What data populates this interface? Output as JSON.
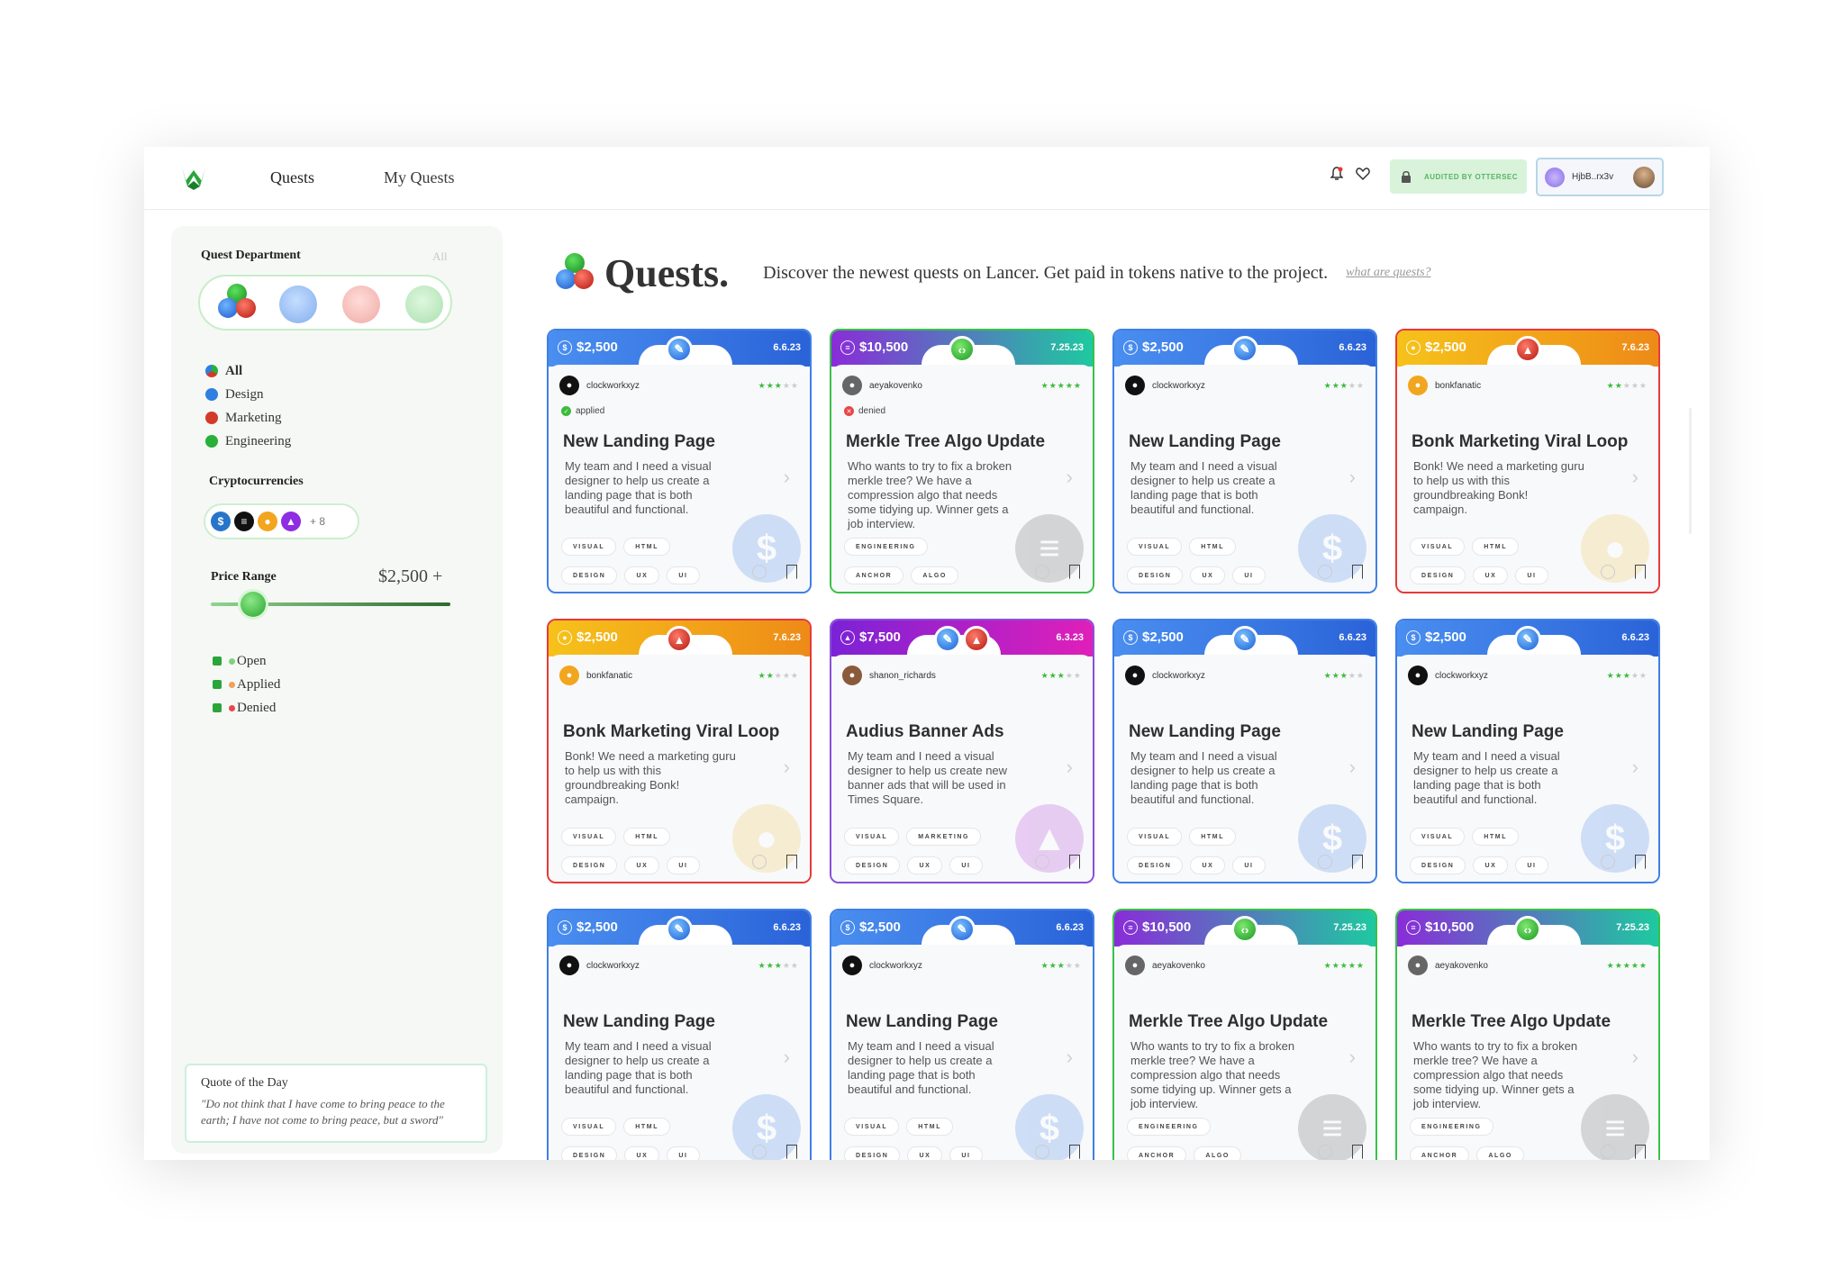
{
  "nav": {
    "links": [
      "Quests",
      "My Quests"
    ],
    "audit_label": "AUDITED BY OTTERSEC",
    "wallet_address": "HjbB..rx3v"
  },
  "sidebar": {
    "dept_title": "Quest Department",
    "dept_all": "All",
    "departments": [
      "All",
      "Design",
      "Marketing",
      "Engineering"
    ],
    "crypto_title": "Cryptocurrencies",
    "crypto_more": "+ 8",
    "price_title": "Price Range",
    "price_value": "$2,500 +",
    "price_slider_fraction": 0.15,
    "statuses": [
      "Open",
      "Applied",
      "Denied"
    ],
    "quote_title": "Quote of the Day",
    "quote_text": "\"Do not think that I have come to bring peace to the earth; I have not come to bring peace, but a sword\""
  },
  "header": {
    "title": "Quests.",
    "subtitle": "Discover the newest quests on Lancer. Get paid in tokens native to the project.",
    "link": "what are quests?"
  },
  "colors": {
    "design": "#2f7fe0",
    "engineering": "#27b03a",
    "marketing": "#d23a2a",
    "bonk": "#f0b020",
    "audius": "#b01fd0"
  },
  "cards": [
    {
      "price": "$2,500",
      "date": "6.6.23",
      "user": "clockworkxyz",
      "stars": 3,
      "status": "applied",
      "title": "New Landing Page",
      "desc": "My team and I need a visual designer to help us create a landing page that is both beautiful and functional.",
      "tags": [
        "VISUAL",
        "HTML",
        "DESIGN",
        "UX",
        "UI"
      ],
      "theme": "design"
    },
    {
      "price": "$10,500",
      "date": "7.25.23",
      "user": "aeyakovenko",
      "stars": 5,
      "status": "denied",
      "title": "Merkle Tree Algo Update",
      "desc": "Who wants to try to fix a broken merkle tree? We have a compression algo that needs some tidying up. Winner gets a job interview.",
      "tags": [
        "ENGINEERING",
        "ANCHOR",
        "ALGO"
      ],
      "theme": "engineering"
    },
    {
      "price": "$2,500",
      "date": "6.6.23",
      "user": "clockworkxyz",
      "stars": 3,
      "status": "",
      "title": "New Landing Page",
      "desc": "My team and I need a visual designer to help us create a landing page that is both beautiful and functional.",
      "tags": [
        "VISUAL",
        "HTML",
        "DESIGN",
        "UX",
        "UI"
      ],
      "theme": "design"
    },
    {
      "price": "$2,500",
      "date": "7.6.23",
      "user": "bonkfanatic",
      "stars": 2,
      "status": "",
      "title": "Bonk Marketing Viral Loop",
      "desc": "Bonk! We need a marketing guru to help us with this groundbreaking Bonk! campaign.",
      "tags": [
        "VISUAL",
        "HTML",
        "DESIGN",
        "UX",
        "UI"
      ],
      "theme": "bonk"
    },
    {
      "price": "$2,500",
      "date": "7.6.23",
      "user": "bonkfanatic",
      "stars": 2,
      "status": "",
      "title": "Bonk Marketing Viral Loop",
      "desc": "Bonk! We need a marketing guru to help us with this groundbreaking Bonk! campaign.",
      "tags": [
        "VISUAL",
        "HTML",
        "DESIGN",
        "UX",
        "UI"
      ],
      "theme": "bonk"
    },
    {
      "price": "$7,500",
      "date": "6.3.23",
      "user": "shanon_richards",
      "stars": 3,
      "status": "",
      "title": "Audius Banner Ads",
      "desc": "My team and I need a visual designer to help us create new banner ads that will be used in Times Square.",
      "tags": [
        "VISUAL",
        "MARKETING",
        "DESIGN",
        "UX",
        "UI"
      ],
      "theme": "audius"
    },
    {
      "price": "$2,500",
      "date": "6.6.23",
      "user": "clockworkxyz",
      "stars": 3,
      "status": "",
      "title": "New Landing Page",
      "desc": "My team and I need a visual designer to help us create a landing page that is both beautiful and functional.",
      "tags": [
        "VISUAL",
        "HTML",
        "DESIGN",
        "UX",
        "UI"
      ],
      "theme": "design"
    },
    {
      "price": "$2,500",
      "date": "6.6.23",
      "user": "clockworkxyz",
      "stars": 3,
      "status": "",
      "title": "New Landing Page",
      "desc": "My team and I need a visual designer to help us create a landing page that is both beautiful and functional.",
      "tags": [
        "VISUAL",
        "HTML",
        "DESIGN",
        "UX",
        "UI"
      ],
      "theme": "design"
    },
    {
      "price": "$2,500",
      "date": "6.6.23",
      "user": "clockworkxyz",
      "stars": 3,
      "status": "",
      "title": "New Landing Page",
      "desc": "My team and I need a visual designer to help us create a landing page that is both beautiful and functional.",
      "tags": [
        "VISUAL",
        "HTML",
        "DESIGN",
        "UX",
        "UI"
      ],
      "theme": "design"
    },
    {
      "price": "$2,500",
      "date": "6.6.23",
      "user": "clockworkxyz",
      "stars": 3,
      "status": "",
      "title": "New Landing Page",
      "desc": "My team and I need a visual designer to help us create a landing page that is both beautiful and functional.",
      "tags": [
        "VISUAL",
        "HTML",
        "DESIGN",
        "UX",
        "UI"
      ],
      "theme": "design"
    },
    {
      "price": "$10,500",
      "date": "7.25.23",
      "user": "aeyakovenko",
      "stars": 5,
      "status": "",
      "title": "Merkle Tree Algo Update",
      "desc": "Who wants to try to fix a broken merkle tree? We have a compression algo that needs some tidying up. Winner gets a job interview.",
      "tags": [
        "ENGINEERING",
        "ANCHOR",
        "ALGO"
      ],
      "theme": "engineering"
    },
    {
      "price": "$10,500",
      "date": "7.25.23",
      "user": "aeyakovenko",
      "stars": 5,
      "status": "",
      "title": "Merkle Tree Algo Update",
      "desc": "Who wants to try to fix a broken merkle tree? We have a compression algo that needs some tidying up. Winner gets a job interview.",
      "tags": [
        "ENGINEERING",
        "ANCHOR",
        "ALGO"
      ],
      "theme": "engineering"
    }
  ]
}
